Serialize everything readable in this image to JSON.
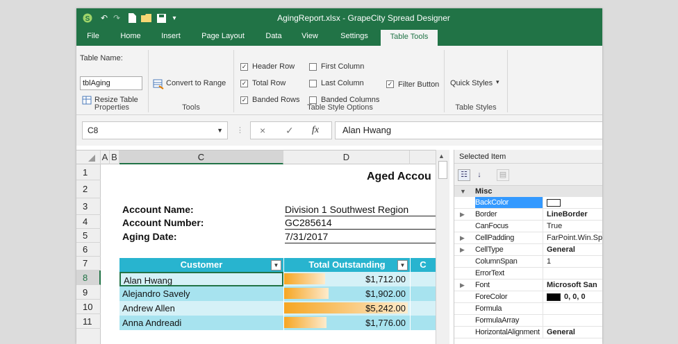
{
  "window": {
    "title": "AgingReport.xlsx - GrapeCity Spread Designer"
  },
  "ribbon_tabs": [
    "File",
    "Home",
    "Insert",
    "Page Layout",
    "Data",
    "View",
    "Settings",
    "Table Tools"
  ],
  "ribbon": {
    "properties": {
      "table_name_label": "Table Name:",
      "table_name_value": "tblAging",
      "resize_label": "Resize Table",
      "group_label": "Properties"
    },
    "tools": {
      "convert_label": "Convert to Range",
      "group_label": "Tools"
    },
    "style_options": {
      "header_row": "Header Row",
      "total_row": "Total Row",
      "banded_rows": "Banded Rows",
      "first_column": "First Column",
      "last_column": "Last Column",
      "banded_columns": "Banded Columns",
      "filter_button": "Filter Button",
      "group_label": "Table Style Options",
      "check_mark": "✓"
    },
    "styles": {
      "quick_styles_label": "Quick Styles",
      "group_label": "Table Styles"
    }
  },
  "formula_bar": {
    "name_box": "C8",
    "formula": "Alan Hwang",
    "cancel_glyph": "×",
    "enter_glyph": "✓",
    "fx_glyph": "fx"
  },
  "sheet": {
    "col_headers": [
      "A",
      "B",
      "C",
      "D"
    ],
    "row_numbers": [
      "1",
      "2",
      "3",
      "4",
      "5",
      "6",
      "7",
      "8",
      "9",
      "10",
      "11"
    ],
    "title": "Aged Accou",
    "info_labels": [
      "Account Name:",
      "Account Number:",
      "Aging Date:"
    ],
    "info_values": [
      "Division 1 Southwest Region",
      "GC285614",
      "7/31/2017"
    ],
    "table_headers": {
      "customer": "Customer",
      "total": "Total Outstanding",
      "next": "C"
    },
    "rows": [
      {
        "customer": "Alan Hwang",
        "total": "$1,712.00",
        "bar_fraction": 0.33
      },
      {
        "customer": "Alejandro Savely",
        "total": "$1,902.00",
        "bar_fraction": 0.36
      },
      {
        "customer": "Andrew Allen",
        "total": "$5,242.00",
        "bar_fraction": 1.0
      },
      {
        "customer": "Anna Andreadi",
        "total": "$1,776.00",
        "bar_fraction": 0.34
      }
    ]
  },
  "property_panel": {
    "header": "Selected Item",
    "category": "Misc",
    "rows": [
      {
        "name": "BackColor",
        "value": "",
        "swatch": "#ffffff",
        "selected": true
      },
      {
        "name": "Border",
        "value": "LineBorder",
        "bold": true,
        "expandable": true
      },
      {
        "name": "CanFocus",
        "value": "True"
      },
      {
        "name": "CellPadding",
        "value": "FarPoint.Win.Sp",
        "expandable": true
      },
      {
        "name": "CellType",
        "value": "General",
        "bold": true,
        "expandable": true
      },
      {
        "name": "ColumnSpan",
        "value": "1"
      },
      {
        "name": "ErrorText",
        "value": ""
      },
      {
        "name": "Font",
        "value": "Microsoft San",
        "bold": true,
        "expandable": true
      },
      {
        "name": "ForeColor",
        "value": "0, 0, 0",
        "swatch": "#000000",
        "bold": true
      },
      {
        "name": "Formula",
        "value": ""
      },
      {
        "name": "FormulaArray",
        "value": ""
      },
      {
        "name": "HorizontalAlignment",
        "value": "General",
        "bold": true
      }
    ]
  },
  "colors": {
    "brand_green": "#217346",
    "table_header": "#28b4cf",
    "band_light": "#d5f1f7",
    "band_dark": "#a7e3ef",
    "data_bar": "#f6a623",
    "selection": "#3399ff"
  }
}
